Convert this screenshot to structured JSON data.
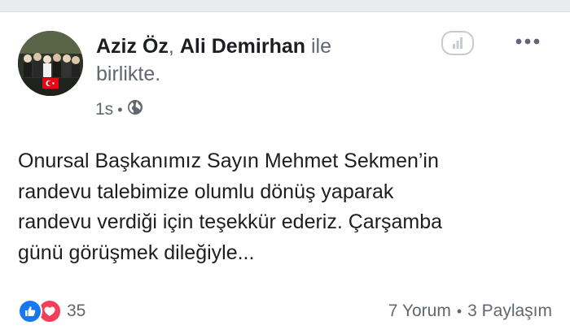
{
  "post": {
    "author_primary": "Aziz Öz",
    "comma": ",",
    "author_tagged": "Ali Demirhan",
    "with_prefix": "ile",
    "with_suffix": "birlikte.",
    "timestamp": "1s",
    "audience_icon": "globe-icon",
    "text_lines": [
      "Onursal Başkanımız Sayın Mehmet Sekmen’in",
      "randevu talebimize olumlu dönüş yaparak",
      "randevu verdiği için teşekkür ederiz. Çarşamba",
      "günü görüşmek dileğiyle..."
    ]
  },
  "header_actions": {
    "insights_icon": "insights-icon",
    "more_icon": "more-options-icon"
  },
  "footer": {
    "reaction_icons": [
      "like-icon",
      "love-icon"
    ],
    "reaction_count": "35",
    "comments": "7 Yorum",
    "separator": "•",
    "shares": "3 Paylaşım"
  },
  "colors": {
    "like": "#1877f2",
    "love": "#f33e58",
    "secondary_text": "#606770",
    "primary_text": "#1c1e21"
  }
}
